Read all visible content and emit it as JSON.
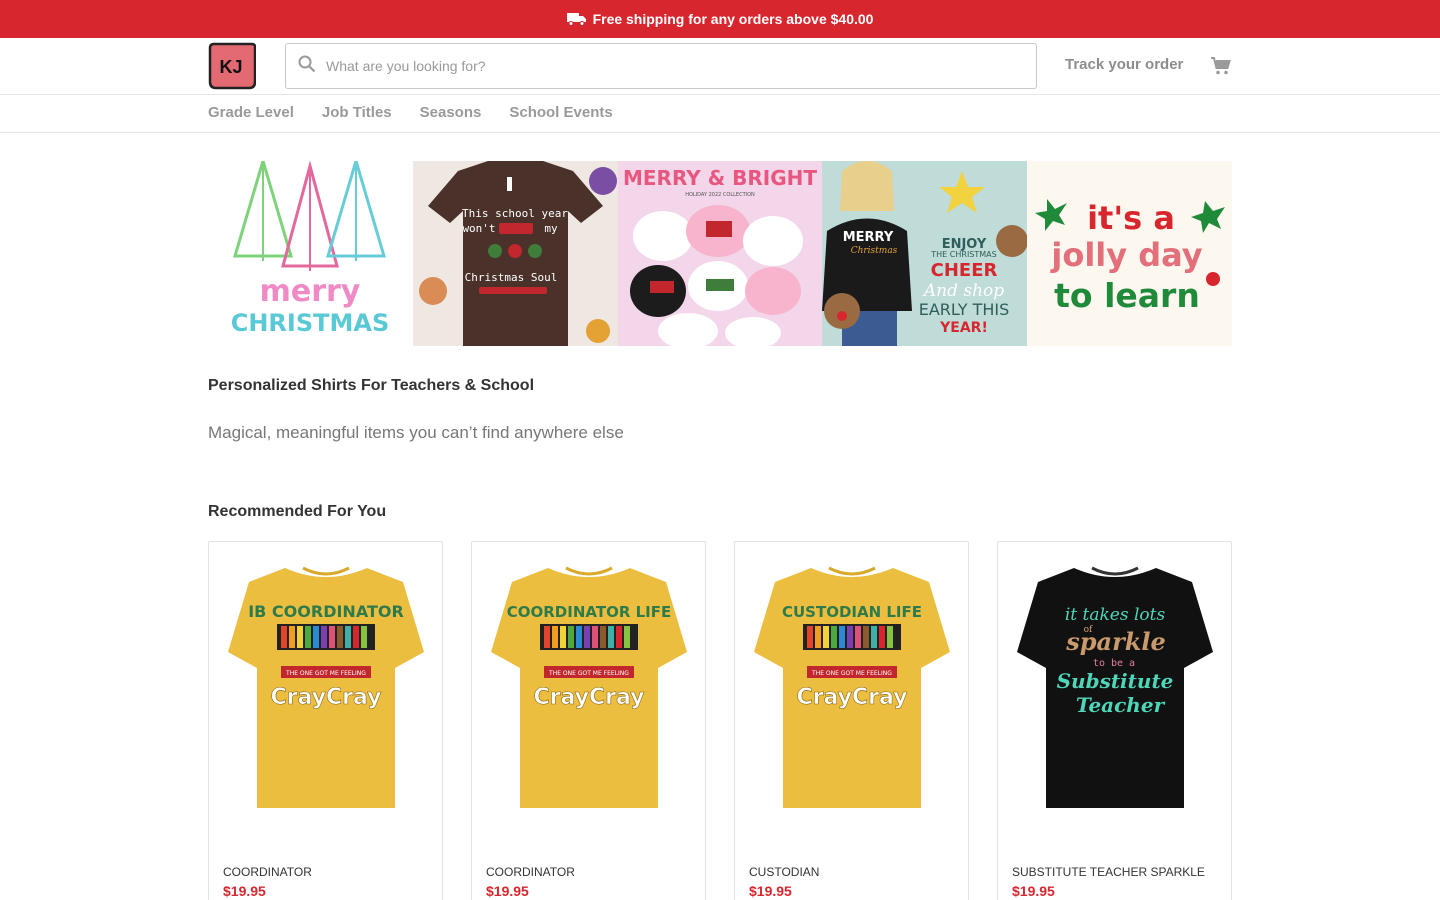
{
  "promo": {
    "text": "Free shipping for any orders above $40.00",
    "icon": "truck-icon"
  },
  "header": {
    "logo_text": "KJ",
    "search_placeholder": "What are you looking for?",
    "track_label": "Track your order",
    "cart_icon": "cart-icon"
  },
  "nav": {
    "items": [
      "Grade Level",
      "Job Titles",
      "Seasons",
      "School Events"
    ]
  },
  "banners": [
    {
      "lines": [
        "merry",
        "CHRISTMAS"
      ]
    },
    {
      "lines": [
        "This school year",
        "won't",
        "my",
        "Christmas Soul"
      ]
    },
    {
      "lines": [
        "MERRY & BRIGHT",
        "HOLIDAY 2022 COLLECTION"
      ]
    },
    {
      "lines": [
        "MERRY",
        "Christmas",
        "ENJOY",
        "THE CHRISTMAS",
        "CHEER",
        "And shop",
        "EARLY THIS",
        "YEAR!"
      ]
    },
    {
      "lines": [
        "it's a",
        "jolly day",
        "to learn"
      ]
    }
  ],
  "main": {
    "title": "Personalized Shirts For Teachers & School",
    "subtitle": "Magical, meaningful items you can’t find anywhere else",
    "recommended_title": "Recommended For You"
  },
  "products": [
    {
      "name": "COORDINATOR",
      "price": "$19.95",
      "shirt_color": "#ecbe3f",
      "print": [
        "IB COORDINATOR",
        "THE ONE GOT ME FEELING",
        "CrayCray"
      ]
    },
    {
      "name": "COORDINATOR",
      "price": "$19.95",
      "shirt_color": "#ecbe3f",
      "print": [
        "COORDINATOR LIFE",
        "THE ONE GOT ME FEELING",
        "CrayCray"
      ]
    },
    {
      "name": "CUSTODIAN",
      "price": "$19.95",
      "shirt_color": "#ecbe3f",
      "print": [
        "CUSTODIAN LIFE",
        "THE ONE GOT ME FEELING",
        "CrayCray"
      ]
    },
    {
      "name": "SUBSTITUTE TEACHER SPARKLE",
      "price": "$19.95",
      "shirt_color": "#111111",
      "print": [
        "it takes lots",
        "of",
        "sparkle",
        "to be a",
        "Substitute",
        "Teacher"
      ]
    }
  ],
  "colors": {
    "brand_red": "#d8262e",
    "price_red": "#d8262e"
  }
}
